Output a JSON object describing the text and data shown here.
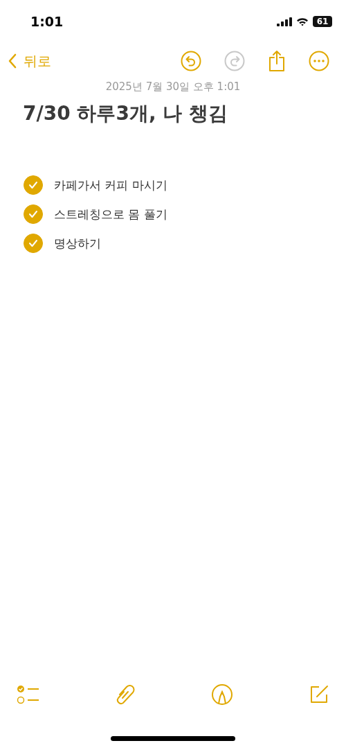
{
  "status_bar": {
    "time": "1:01",
    "battery": "61"
  },
  "nav": {
    "back": "뒤로",
    "undo": {
      "disabled": false
    },
    "redo": {
      "disabled": true
    }
  },
  "note": {
    "date": "2025년 7월 30일 오후 1:01",
    "title": "7/30 하루3개, 나 챙김",
    "checklist": [
      {
        "text": "카페가서 커피 마시기",
        "checked": true
      },
      {
        "text": "스트레칭으로 몸 풀기",
        "checked": true
      },
      {
        "text": "명상하기",
        "checked": true
      }
    ]
  }
}
